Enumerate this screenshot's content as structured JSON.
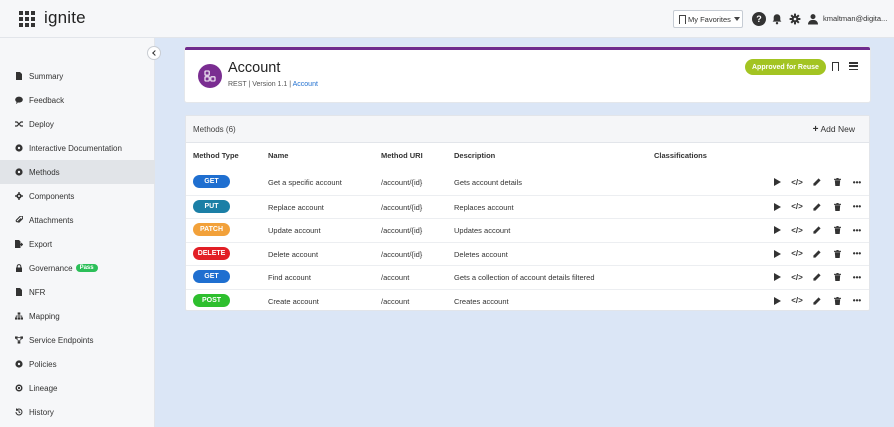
{
  "app": {
    "logo": "ignite"
  },
  "header": {
    "favorites_label": "My Favorites",
    "username": "kmaltman@digita..."
  },
  "sidebar": {
    "items": [
      {
        "label": "Summary",
        "icon": "document-icon"
      },
      {
        "label": "Feedback",
        "icon": "comment-icon"
      },
      {
        "label": "Deploy",
        "icon": "shuffle-icon"
      },
      {
        "label": "Interactive Documentation",
        "icon": "circle-icon"
      },
      {
        "label": "Methods",
        "icon": "circle-icon",
        "active": true
      },
      {
        "label": "Components",
        "icon": "gear-icon"
      },
      {
        "label": "Attachments",
        "icon": "paperclip-icon"
      },
      {
        "label": "Export",
        "icon": "export-icon"
      },
      {
        "label": "Governance",
        "icon": "lock-icon",
        "badge": "Pass"
      },
      {
        "label": "NFR",
        "icon": "document-icon"
      },
      {
        "label": "Mapping",
        "icon": "sitemap-icon"
      },
      {
        "label": "Service Endpoints",
        "icon": "network-icon"
      },
      {
        "label": "Policies",
        "icon": "circle-icon"
      },
      {
        "label": "Lineage",
        "icon": "link-icon"
      },
      {
        "label": "History",
        "icon": "history-icon"
      }
    ]
  },
  "account": {
    "title": "Account",
    "subtitle_prefix": "REST | Version 1.1 | ",
    "subtitle_link": "Account",
    "status": "Approved for Reuse",
    "status_color": "#a3c422",
    "accent_color": "#6e2b8d"
  },
  "methods": {
    "title": "Methods (6)",
    "add_label": "Add New",
    "headers": {
      "type": "Method Type",
      "name": "Name",
      "uri": "Method URI",
      "description": "Description",
      "classifications": "Classifications"
    },
    "rows": [
      {
        "type": "GET",
        "color": "#1f6fd0",
        "name": "Get a specific account",
        "uri": "/account/{id}",
        "description": "Gets account details"
      },
      {
        "type": "PUT",
        "color": "#1b7fa6",
        "name": "Replace account",
        "uri": "/account/{id}",
        "description": "Replaces account"
      },
      {
        "type": "PATCH",
        "color": "#f2a13a",
        "name": "Update account",
        "uri": "/account/{id}",
        "description": "Updates account"
      },
      {
        "type": "DELETE",
        "color": "#e21f26",
        "name": "Delete account",
        "uri": "/account/{id}",
        "description": "Deletes account"
      },
      {
        "type": "GET",
        "color": "#1f6fd0",
        "name": "Find account",
        "uri": "/account",
        "description": "Gets a collection of account details filtered"
      },
      {
        "type": "POST",
        "color": "#2ebf2e",
        "name": "Create account",
        "uri": "/account",
        "description": "Creates account"
      }
    ]
  }
}
